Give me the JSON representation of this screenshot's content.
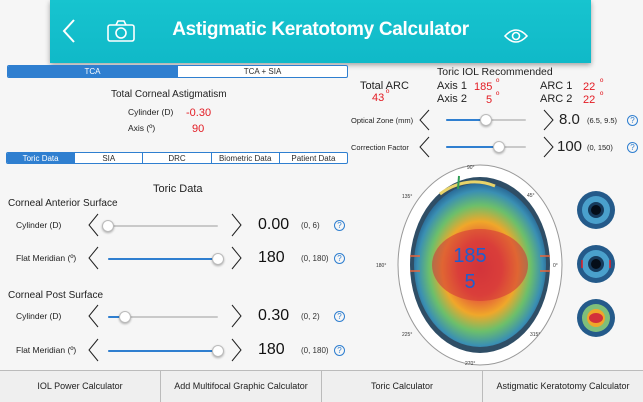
{
  "header": {
    "title": "Astigmatic Keratotomy Calculator"
  },
  "mode_tabs": [
    "TCA",
    "TCA + SIA"
  ],
  "tca": {
    "title": "Total Corneal Astigmatism",
    "cylinder_label": "Cylinder (D)",
    "cylinder_value": "-0.30",
    "axis_label": "Axis (º)",
    "axis_value": "90"
  },
  "arc": {
    "total_label": "Total ARC",
    "total_value": "43",
    "deg": "º",
    "toric_title": "Toric IOL Recommended",
    "axis1_label": "Axis 1",
    "axis1_value": "185",
    "axis2_label": "Axis 2",
    "axis2_value": "5",
    "arc1_label": "ARC 1",
    "arc1_value": "22",
    "arc2_label": "ARC 2",
    "arc2_value": "22"
  },
  "optical_zone": {
    "label": "Optical Zone (mm)",
    "value": "8.0",
    "range": "(6.5, 9.5)",
    "fraction": 0.5
  },
  "correction_factor": {
    "label": "Correction Factor",
    "value": "100",
    "range": "(0, 150)",
    "fraction": 0.667
  },
  "data_tabs": [
    "Toric Data",
    "SIA",
    "DRC",
    "Biometric Data",
    "Patient Data"
  ],
  "toric": {
    "title": "Toric Data",
    "anterior_title": "Corneal Anterior Surface",
    "posterior_title": "Corneal Post Surface",
    "ant_cyl": {
      "label": "Cylinder (D)",
      "value": "0.00",
      "range": "(0, 6)",
      "fraction": 0.0
    },
    "ant_flat": {
      "label": "Flat Meridian (º)",
      "value": "180",
      "range": "(0, 180)",
      "fraction": 1.0
    },
    "post_cyl": {
      "label": "Cylinder (D)",
      "value": "0.30",
      "range": "(0, 2)",
      "fraction": 0.15
    },
    "post_flat": {
      "label": "Flat Meridian (º)",
      "value": "180",
      "range": "(0, 180)",
      "fraction": 1.0
    }
  },
  "map": {
    "value_top": "185",
    "value_bottom": "5",
    "degrees": [
      "90°",
      "45°",
      "135°",
      "0°",
      "180°",
      "225°",
      "315°",
      "270°"
    ]
  },
  "help_glyph": "?",
  "bottom_tabs": [
    "IOL Power Calculator",
    "Add Multifocal Graphic Calculator",
    "Toric Calculator",
    "Astigmatic Keratotomy Calculator"
  ],
  "colors": {
    "header": "#14bfcc",
    "accent": "#2f7fd0",
    "value_red": "#e31b23"
  },
  "icons": [
    "back-chevron-icon",
    "camera-icon",
    "eye-icon",
    "chevron-left-icon",
    "chevron-right-icon",
    "help-icon"
  ]
}
